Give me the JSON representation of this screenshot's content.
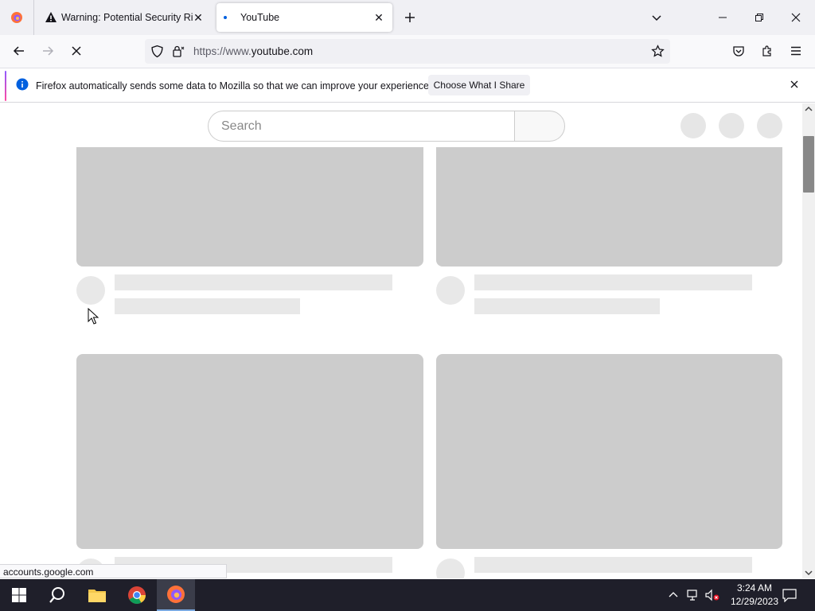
{
  "tabs": [
    {
      "title": "Warning: Potential Security Risk Ahead",
      "icon": "warning-icon",
      "active": false
    },
    {
      "title": "YouTube",
      "icon": "loading-dot-icon",
      "active": true
    }
  ],
  "navbar": {
    "url_prefix": "https://www.",
    "url_domain": "youtube.com"
  },
  "notification": {
    "message": "Firefox automatically sends some data to Mozilla so that we can improve your experience.",
    "button": "Choose What I Share"
  },
  "page": {
    "search_placeholder": "Search"
  },
  "status_bar": "accounts.google.com",
  "taskbar": {
    "time": "3:24 AM",
    "date": "12/29/2023"
  },
  "colors": {
    "skeleton_thumb": "#cccccc",
    "skeleton_line": "#e8e8e8",
    "taskbar": "#1f1f2a"
  }
}
